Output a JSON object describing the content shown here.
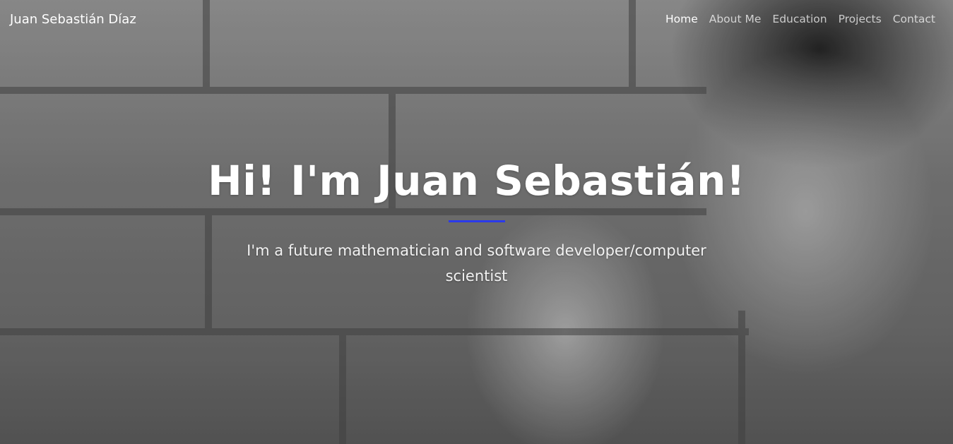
{
  "navbar": {
    "brand": "Juan Sebastián Díaz",
    "links": [
      {
        "label": "Home",
        "active": true
      },
      {
        "label": "About Me",
        "active": false
      },
      {
        "label": "Education",
        "active": false
      },
      {
        "label": "Projects",
        "active": false
      },
      {
        "label": "Contact",
        "active": false
      }
    ]
  },
  "hero": {
    "title": "Hi! I'm Juan Sebastián!",
    "subtitle": "I'm a future mathematician and software developer/computer scientist",
    "background": "grayscale-photo-brick-wall-person",
    "divider_color": "#2b3aeb"
  }
}
